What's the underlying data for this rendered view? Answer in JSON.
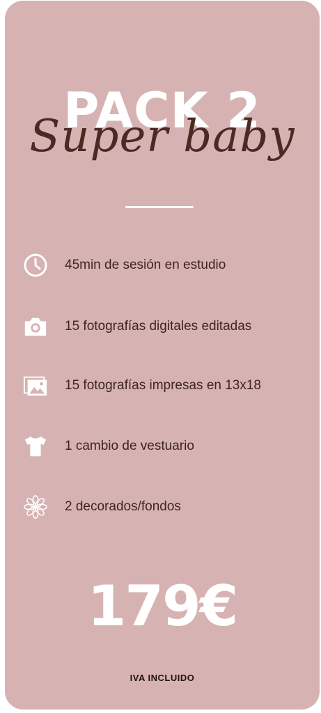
{
  "pack": {
    "title": "PACK 2",
    "subtitle": "Super baby"
  },
  "features": [
    {
      "icon": "clock-icon",
      "label": "45min de sesión en estudio"
    },
    {
      "icon": "camera-icon",
      "label": "15 fotografías digitales editadas"
    },
    {
      "icon": "photos-icon",
      "label": "15 fotografías impresas en 13x18"
    },
    {
      "icon": "tshirt-icon",
      "label": "1 cambio de vestuario"
    },
    {
      "icon": "flower-icon",
      "label": "2 decorados/fondos"
    }
  ],
  "price": "179€",
  "tax_note": "IVA INCLUIDO",
  "colors": {
    "card_background": "#d6b3b2",
    "script_text": "#4a2a22",
    "body_text": "#3e2520",
    "accent": "#ffffff"
  }
}
